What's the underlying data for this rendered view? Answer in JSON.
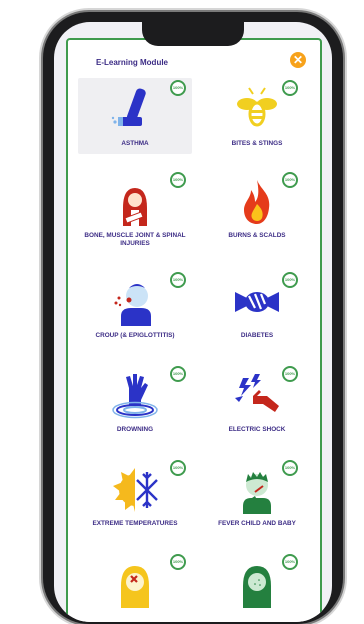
{
  "header": {
    "title": "E-Learning Module"
  },
  "colors": {
    "brand_purple": "#3d2d86",
    "green": "#3f9b4e",
    "orange": "#f7a21b"
  },
  "modules": [
    {
      "label": "ASTHMA",
      "progress": "100%",
      "icon": "inhaler-icon"
    },
    {
      "label": "BITES & STINGS",
      "progress": "100%",
      "icon": "bee-icon"
    },
    {
      "label": "BONE, MUSCLE JOINT & SPINAL INJURIES",
      "progress": "100%",
      "icon": "injured-person-icon"
    },
    {
      "label": "BURNS & SCALDS",
      "progress": "100%",
      "icon": "flame-icon"
    },
    {
      "label": "CROUP (& EPIGLOTTITIS)",
      "progress": "100%",
      "icon": "coughing-child-icon"
    },
    {
      "label": "DIABETES",
      "progress": "100%",
      "icon": "candy-icon"
    },
    {
      "label": "DROWNING",
      "progress": "100%",
      "icon": "drowning-hand-icon"
    },
    {
      "label": "ELECTRIC SHOCK",
      "progress": "100%",
      "icon": "electric-shock-icon"
    },
    {
      "label": "EXTREME TEMPERATURES",
      "progress": "100%",
      "icon": "sun-snowflake-icon"
    },
    {
      "label": "FEVER CHILD AND BABY",
      "progress": "100%",
      "icon": "fever-child-icon"
    },
    {
      "label": "",
      "progress": "100%",
      "icon": "person-icon"
    },
    {
      "label": "",
      "progress": "100%",
      "icon": "person-icon"
    }
  ]
}
